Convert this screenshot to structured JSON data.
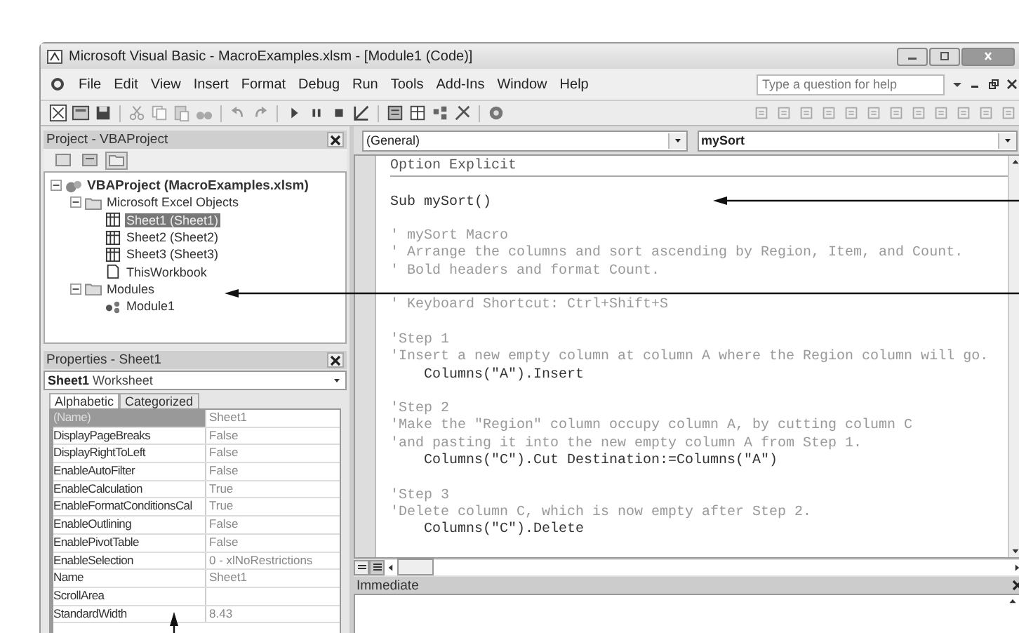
{
  "window": {
    "title": "Microsoft Visual Basic - MacroExamples.xlsm - [Module1 (Code)]"
  },
  "menu": [
    "File",
    "Edit",
    "View",
    "Insert",
    "Format",
    "Debug",
    "Run",
    "Tools",
    "Add-Ins",
    "Window",
    "Help"
  ],
  "help_box": {
    "placeholder": "Type a question for help"
  },
  "project_pane": {
    "title": "Project - VBAProject",
    "tree": [
      {
        "label": "VBAProject (MacroExamples.xlsm)",
        "kind": "project",
        "expanded": true,
        "selected": false,
        "children": [
          {
            "label": "Microsoft Excel Objects",
            "kind": "folder",
            "expanded": true,
            "selected": false,
            "children": [
              {
                "label": "Sheet1 (Sheet1)",
                "kind": "sheet",
                "selected": true
              },
              {
                "label": "Sheet2 (Sheet2)",
                "kind": "sheet",
                "selected": false
              },
              {
                "label": "Sheet3 (Sheet3)",
                "kind": "sheet",
                "selected": false
              },
              {
                "label": "ThisWorkbook",
                "kind": "workbook",
                "selected": false
              }
            ]
          },
          {
            "label": "Modules",
            "kind": "folder",
            "expanded": true,
            "selected": false,
            "children": [
              {
                "label": "Module1",
                "kind": "module",
                "selected": false
              }
            ]
          }
        ]
      }
    ]
  },
  "properties_pane": {
    "title": "Properties - Sheet1",
    "object": {
      "name": "Sheet1",
      "type": "Worksheet"
    },
    "tabs": [
      {
        "label": "Alphabetic",
        "selected": true
      },
      {
        "label": "Categorized",
        "selected": false
      }
    ],
    "rows": [
      {
        "name": "(Name)",
        "value": "Sheet1",
        "selected": true
      },
      {
        "name": "DisplayPageBreaks",
        "value": "False",
        "selected": false
      },
      {
        "name": "DisplayRightToLeft",
        "value": "False",
        "selected": false
      },
      {
        "name": "EnableAutoFilter",
        "value": "False",
        "selected": false
      },
      {
        "name": "EnableCalculation",
        "value": "True",
        "selected": false
      },
      {
        "name": "EnableFormatConditionsCal",
        "value": "True",
        "selected": false
      },
      {
        "name": "EnableOutlining",
        "value": "False",
        "selected": false
      },
      {
        "name": "EnablePivotTable",
        "value": "False",
        "selected": false
      },
      {
        "name": "EnableSelection",
        "value": "0 - xlNoRestrictions",
        "selected": false
      },
      {
        "name": "Name",
        "value": "Sheet1",
        "selected": false
      },
      {
        "name": "ScrollArea",
        "selected": false
      },
      {
        "name": "StandardWidth",
        "value": "8.43",
        "selected": false
      }
    ]
  },
  "code_pane": {
    "object_box": "(General)",
    "procedure_box": "mySort",
    "lines": [
      {
        "kind": "declaration",
        "text": "Option Explicit"
      },
      {
        "kind": "blank"
      },
      {
        "kind": "code",
        "text": "Sub mySort()"
      },
      {
        "kind": "blank"
      },
      {
        "kind": "comment",
        "text": "' mySort Macro"
      },
      {
        "kind": "comment",
        "text": "' Arrange the columns and sort ascending by Region, Item, and Count."
      },
      {
        "kind": "comment",
        "text": "' Bold headers and format Count."
      },
      {
        "kind": "blank"
      },
      {
        "kind": "comment",
        "text": "' Keyboard Shortcut: Ctrl+Shift+S"
      },
      {
        "kind": "blank"
      },
      {
        "kind": "comment",
        "text": "'Step 1"
      },
      {
        "kind": "comment",
        "text": "'Insert a new empty column at column A where the Region column will go."
      },
      {
        "kind": "code",
        "text": "    Columns(\"A\").Insert"
      },
      {
        "kind": "blank"
      },
      {
        "kind": "comment",
        "text": "'Step 2"
      },
      {
        "kind": "comment",
        "text": "'Make the \"Region\" column occupy column A, by cutting column C"
      },
      {
        "kind": "comment",
        "text": "'and pasting it into the new empty column A from Step 1."
      },
      {
        "kind": "code",
        "text": "    Columns(\"C\").Cut Destination:=Columns(\"A\")"
      },
      {
        "kind": "blank"
      },
      {
        "kind": "comment",
        "text": "'Step 3"
      },
      {
        "kind": "comment",
        "text": "'Delete column C, which is now empty after Step 2."
      },
      {
        "kind": "code",
        "text": "    Columns(\"C\").Delete"
      }
    ]
  },
  "immediate_pane": {
    "title": "Immediate"
  }
}
